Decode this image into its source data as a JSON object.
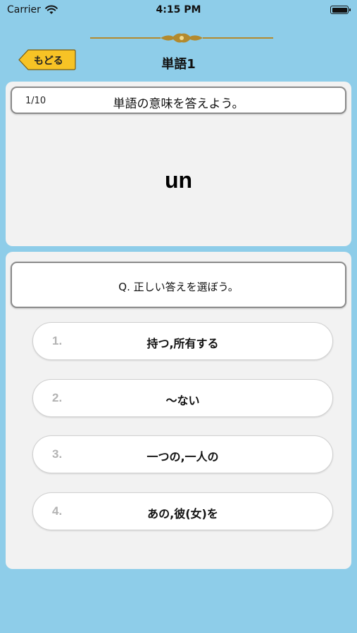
{
  "status_bar": {
    "carrier": "Carrier",
    "time": "4:15 PM"
  },
  "header": {
    "back_label": "もどる",
    "title": "単語1"
  },
  "question": {
    "progress": "1/10",
    "instruction": "単語の意味を答えよう。",
    "word": "un"
  },
  "answers": {
    "prompt": "Q. 正しい答えを選ぼう。",
    "options": [
      {
        "number": "1.",
        "text": "持つ,所有する"
      },
      {
        "number": "2.",
        "text": "～ない"
      },
      {
        "number": "3.",
        "text": "一つの,一人の"
      },
      {
        "number": "4.",
        "text": "あの,彼(女)を"
      }
    ]
  },
  "colors": {
    "background": "#8ecde9",
    "panel": "#f2f2f2",
    "back_button": "#f7c325",
    "ornament": "#b38a2e",
    "option_number": "#b3b3b3"
  },
  "icons": [
    "wifi-icon",
    "battery-icon",
    "ornament-divider",
    "back-arrow"
  ]
}
